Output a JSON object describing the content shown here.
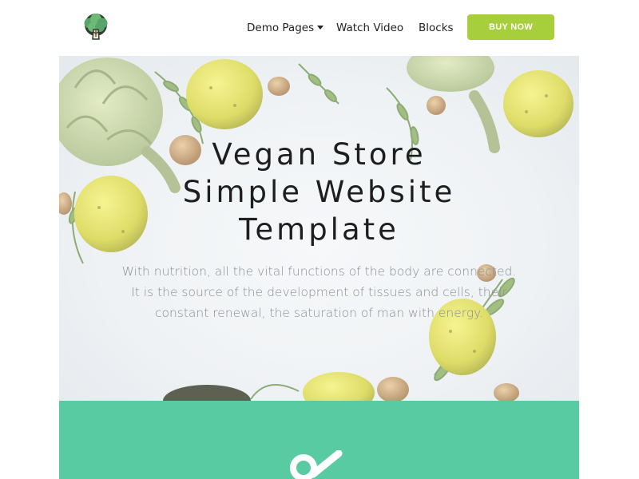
{
  "nav": {
    "logo_icon": "broccoli-tree-icon",
    "items": [
      {
        "label": "Demo Pages",
        "has_caret": true
      },
      {
        "label": "Watch Video"
      },
      {
        "label": "Blocks"
      }
    ],
    "cta_label": "BUY NOW",
    "cta_color": "#a6cf3b"
  },
  "hero": {
    "title_lines": [
      "Vegan Store",
      "Simple Website",
      "Template"
    ],
    "description_lines": [
      "With nutrition, all the vital functions of the body are connected.",
      "It is the source of the development of tissues and cells, their",
      "constant renewal, the saturation of man with energy."
    ],
    "background_image": "vegetables-on-snow"
  },
  "section2": {
    "background_color": "#59cba3",
    "icon": "check-mark-icon"
  }
}
